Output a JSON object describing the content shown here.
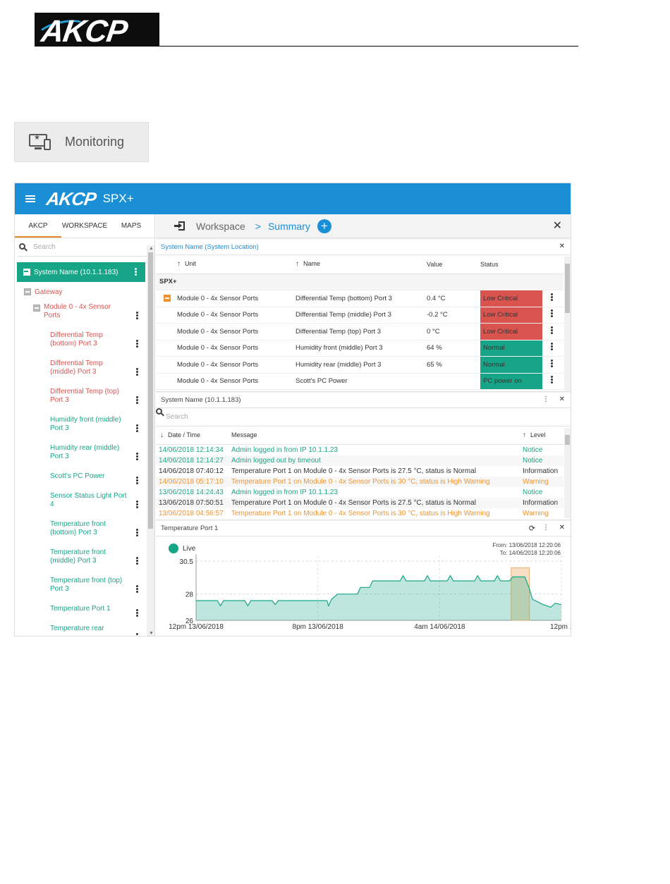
{
  "document": {
    "logo_text": "AKCP",
    "monitoring_button_label": "Monitoring"
  },
  "app": {
    "logo_text": "AKCP",
    "product": "SPX+",
    "colors": {
      "header": "#1a8fd6",
      "green": "#17a587",
      "red": "#d9534f",
      "orange": "#f0932f"
    },
    "sidebar": {
      "tabs": [
        "AKCP",
        "WORKSPACE",
        "MAPS"
      ],
      "active_tab": "AKCP",
      "search_placeholder": "Search",
      "root": "System Name (10.1.1.183)",
      "gateway": "Gateway",
      "module": "Module 0 - 4x Sensor Ports",
      "sensors": [
        {
          "label": "Differential Temp (bottom) Port 3",
          "status": "critical"
        },
        {
          "label": "Differential Temp (middle) Port 3",
          "status": "critical"
        },
        {
          "label": "Differential Temp (top) Port 3",
          "status": "critical"
        },
        {
          "label": "Humidity front (middle) Port 3",
          "status": "normal"
        },
        {
          "label": "Humidity rear (middle) Port 3",
          "status": "normal"
        },
        {
          "label": "Scott's PC Power",
          "status": "normal"
        },
        {
          "label": "Sensor Status Light Port 4",
          "status": "normal"
        },
        {
          "label": "Temperature front (bottom) Port 3",
          "status": "normal"
        },
        {
          "label": "Temperature front (middle) Port 3",
          "status": "normal"
        },
        {
          "label": "Temperature front (top) Port 3",
          "status": "normal"
        },
        {
          "label": "Temperature Port 1",
          "status": "normal"
        },
        {
          "label": "Temperature rear",
          "status": "normal"
        }
      ]
    },
    "breadcrumb": {
      "workspace": "Workspace",
      "separator": ">",
      "current": "Summary",
      "add_label": "+"
    },
    "summary_panel": {
      "title": "System Name (System Location)",
      "columns": {
        "unit": "Unit",
        "name": "Name",
        "value": "Value",
        "status": "Status"
      },
      "group": "SPX+",
      "rows": [
        {
          "unit": "Module 0 - 4x Sensor Ports",
          "name": "Differential Temp (bottom) Port 3",
          "value": "0.4 °C",
          "status": "Low Critical",
          "level": "critical"
        },
        {
          "unit": "Module 0 - 4x Sensor Ports",
          "name": "Differential Temp (middle) Port 3",
          "value": "-0.2 °C",
          "status": "Low Critical",
          "level": "critical"
        },
        {
          "unit": "Module 0 - 4x Sensor Ports",
          "name": "Differential Temp (top) Port 3",
          "value": "0 °C",
          "status": "Low Critical",
          "level": "critical"
        },
        {
          "unit": "Module 0 - 4x Sensor Ports",
          "name": "Humidity front (middle) Port 3",
          "value": "64 %",
          "status": "Normal",
          "level": "normal"
        },
        {
          "unit": "Module 0 - 4x Sensor Ports",
          "name": "Humidity rear (middle) Port 3",
          "value": "65 %",
          "status": "Normal",
          "level": "normal"
        },
        {
          "unit": "Module 0 - 4x Sensor Ports",
          "name": "Scott's PC Power",
          "value": "",
          "status": "PC power on",
          "level": "normal"
        }
      ]
    },
    "log_panel": {
      "title": "System Name (10.1.1.183)",
      "search_placeholder": "Search",
      "columns": {
        "datetime": "Date / Time",
        "message": "Message",
        "level": "Level"
      },
      "rows": [
        {
          "datetime": "14/06/2018 12:14:34",
          "message": "Admin logged in from IP 10.1.1.23",
          "level": "Notice",
          "tone": "green"
        },
        {
          "datetime": "14/06/2018 12:14:27",
          "message": "Admin logged out by timeout",
          "level": "Notice",
          "tone": "green"
        },
        {
          "datetime": "14/06/2018 07:40:12",
          "message": "Temperature Port 1 on Module 0 - 4x Sensor Ports is 27.5 °C, status is Normal",
          "level": "Information",
          "tone": "black"
        },
        {
          "datetime": "14/06/2018 05:17:10",
          "message": "Temperature Port 1 on Module 0 - 4x Sensor Ports is 30 °C, status is High Warning",
          "level": "Warning",
          "tone": "orange"
        },
        {
          "datetime": "13/06/2018 14:24:43",
          "message": "Admin logged in from IP 10.1.1.23",
          "level": "Notice",
          "tone": "green"
        },
        {
          "datetime": "13/06/2018 07:50:51",
          "message": "Temperature Port 1 on Module 0 - 4x Sensor Ports is 27.5 °C, status is Normal",
          "level": "Information",
          "tone": "black"
        },
        {
          "datetime": "13/06/2018 04:56:57",
          "message": "Temperature Port 1 on Module 0 - 4x Sensor Ports is 30 °C, status is High Warning",
          "level": "Warning",
          "tone": "orange"
        }
      ]
    },
    "graph_panel": {
      "title": "Temperature Port 1",
      "legend": "Live",
      "from": "From: 13/06/2018 12:20:06",
      "to": "To: 14/06/2018 12:20:06"
    }
  },
  "chart_data": {
    "type": "area",
    "title": "",
    "xlabel": "",
    "ylabel": "",
    "x_ticks": [
      "12pm 13/06/2018",
      "8pm 13/06/2018",
      "4am 14/06/2018",
      "12pm 14/06/2018"
    ],
    "y_ticks": [
      26,
      28,
      30.5
    ],
    "ylim": [
      26,
      30.5
    ],
    "x_range_hours": [
      0,
      24
    ],
    "grid": true,
    "series": [
      {
        "values": [
          [
            0,
            27.5
          ],
          [
            1.4,
            27.5
          ],
          [
            1.6,
            27.1
          ],
          [
            1.8,
            27.5
          ],
          [
            3.2,
            27.5
          ],
          [
            3.4,
            27.1
          ],
          [
            3.6,
            27.5
          ],
          [
            5.0,
            27.5
          ],
          [
            5.2,
            27.2
          ],
          [
            5.4,
            27.5
          ],
          [
            8.6,
            27.5
          ],
          [
            8.7,
            27.1
          ],
          [
            8.9,
            27.6
          ],
          [
            9.3,
            28.0
          ],
          [
            10.6,
            28.0
          ],
          [
            10.8,
            28.5
          ],
          [
            11.4,
            28.5
          ],
          [
            11.6,
            29.0
          ],
          [
            13.4,
            29.0
          ],
          [
            13.6,
            29.4
          ],
          [
            13.8,
            29.0
          ],
          [
            15.0,
            29.0
          ],
          [
            15.2,
            29.4
          ],
          [
            15.4,
            29.0
          ],
          [
            16.5,
            29.0
          ],
          [
            16.7,
            29.4
          ],
          [
            16.9,
            29.0
          ],
          [
            18.3,
            29.0
          ],
          [
            18.5,
            29.4
          ],
          [
            18.7,
            29.0
          ],
          [
            19.6,
            29.0
          ],
          [
            19.8,
            29.4
          ],
          [
            20.0,
            29.0
          ],
          [
            20.6,
            29.0
          ],
          [
            20.8,
            29.3
          ],
          [
            21.6,
            29.3
          ],
          [
            21.9,
            28.4
          ],
          [
            22.1,
            27.6
          ],
          [
            22.8,
            27.2
          ],
          [
            23.3,
            27.0
          ],
          [
            23.6,
            27.3
          ],
          [
            24.0,
            27.2
          ]
        ],
        "color": "#17a587"
      }
    ],
    "highlight": {
      "from_hour": 20.7,
      "to_hour": 21.9,
      "value": 30.0,
      "color": "#f6dfc4"
    }
  }
}
